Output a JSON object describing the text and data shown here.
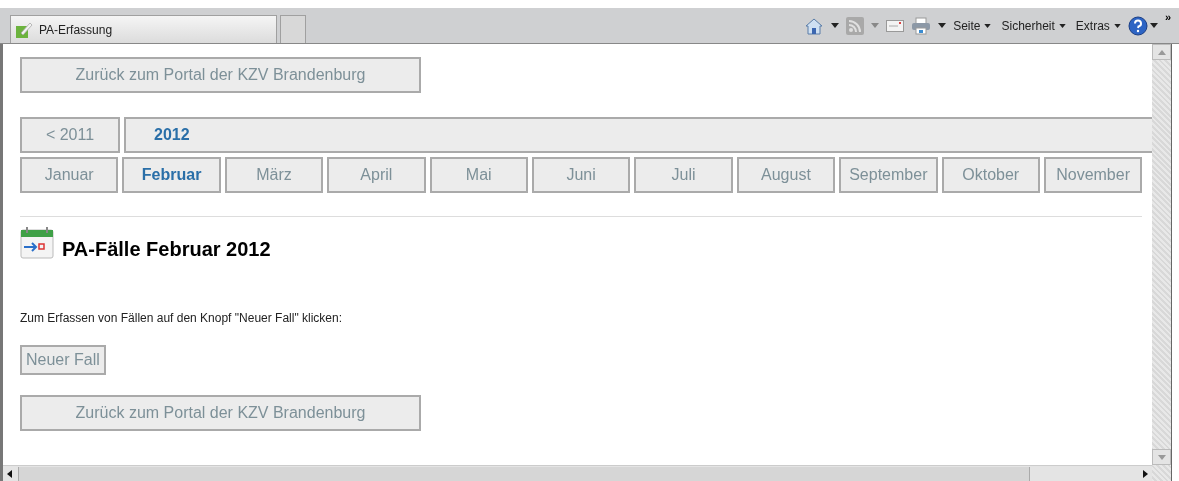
{
  "browser_tab": {
    "title": "PA-Erfassung"
  },
  "toolbar": {
    "menus": [
      {
        "label": "Seite"
      },
      {
        "label": "Sicherheit"
      },
      {
        "label": "Extras"
      }
    ],
    "overflow": "»"
  },
  "top_button": "Zurück zum Portal der KZV Brandenburg",
  "years": [
    {
      "label": "< 2011",
      "selected": false
    },
    {
      "label": "2012",
      "selected": true
    }
  ],
  "months": [
    {
      "label": "Januar",
      "selected": false
    },
    {
      "label": "Februar",
      "selected": true
    },
    {
      "label": "März",
      "selected": false
    },
    {
      "label": "April",
      "selected": false
    },
    {
      "label": "Mai",
      "selected": false
    },
    {
      "label": "Juni",
      "selected": false
    },
    {
      "label": "Juli",
      "selected": false
    },
    {
      "label": "August",
      "selected": false
    },
    {
      "label": "September",
      "selected": false
    },
    {
      "label": "Oktober",
      "selected": false
    },
    {
      "label": "November",
      "selected": false
    }
  ],
  "heading": "PA-Fälle Februar 2012",
  "instruction": "Zum Erfassen von Fällen auf den Knopf \"Neuer Fall\" klicken:",
  "new_case_button": "Neuer Fall",
  "bottom_button": "Zurück zum Portal der KZV Brandenburg"
}
